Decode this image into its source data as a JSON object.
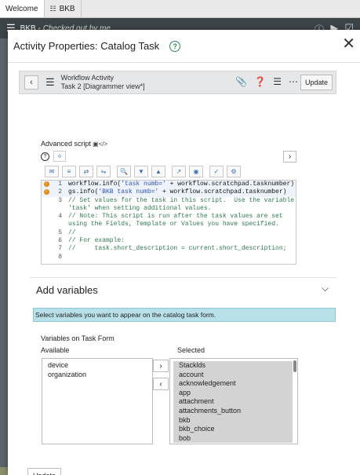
{
  "tabs": [
    {
      "label": "Welcome",
      "icon": ""
    },
    {
      "label": "BKB",
      "icon": "workflow-icon"
    }
  ],
  "appbar": {
    "name": "BKB -",
    "checked_out": "Checked out by me"
  },
  "modal": {
    "title": "Activity Properties: Catalog Task",
    "help": "?"
  },
  "form_header": {
    "line1": "Workflow Activity",
    "line2": "Task 2 [Diagrammer view*]",
    "update_label": "Update"
  },
  "script": {
    "label": "Advanced script",
    "lines": [
      {
        "num": "1",
        "warn": true,
        "parts": [
          [
            "p",
            "workflow.info("
          ],
          [
            "s",
            "'task numb='"
          ],
          [
            "p",
            " + workflow.scratchpad.tasknumber)"
          ]
        ]
      },
      {
        "num": "2",
        "warn": true,
        "parts": [
          [
            "p",
            "gs.info("
          ],
          [
            "s",
            "'BKB task numb='"
          ],
          [
            "p",
            " + workflow.scratchpad.tasknumber)"
          ]
        ]
      },
      {
        "num": "3",
        "warn": false,
        "parts": [
          [
            "c",
            "// Set values for the task in this script.  Use the variable"
          ]
        ]
      },
      {
        "num": "",
        "warn": false,
        "parts": [
          [
            "c",
            "'task' when setting additional values."
          ]
        ]
      },
      {
        "num": "4",
        "warn": false,
        "parts": [
          [
            "c",
            "// Note: This script is run after the task values are set"
          ]
        ]
      },
      {
        "num": "",
        "warn": false,
        "parts": [
          [
            "c",
            "using the Fields, Template or Values you have specified."
          ]
        ]
      },
      {
        "num": "5",
        "warn": false,
        "parts": [
          [
            "c",
            "//"
          ]
        ]
      },
      {
        "num": "6",
        "warn": false,
        "parts": [
          [
            "c",
            "// For example:"
          ]
        ]
      },
      {
        "num": "7",
        "warn": false,
        "parts": [
          [
            "c",
            "//     task.short_description = current.short_description;"
          ]
        ]
      },
      {
        "num": "8",
        "warn": false,
        "parts": [
          [
            "p",
            ""
          ]
        ]
      }
    ]
  },
  "variables": {
    "section_title": "Add variables",
    "info": "Select variables you want to appear on the catalog task form.",
    "label": "Variables on Task Form",
    "available_label": "Available",
    "selected_label": "Selected",
    "available": [
      "device",
      "organization"
    ],
    "selected": [
      "Stacklds",
      "account",
      "acknowledgement",
      "app",
      "attachment",
      "attachments_button",
      "bkb",
      "bkb_choice",
      "bob"
    ]
  },
  "bottom": {
    "update_label": "Update"
  },
  "colors": {
    "comment": "#2f7a4f",
    "string": "#2f53b5",
    "info_bg": "#b8e0e8"
  }
}
